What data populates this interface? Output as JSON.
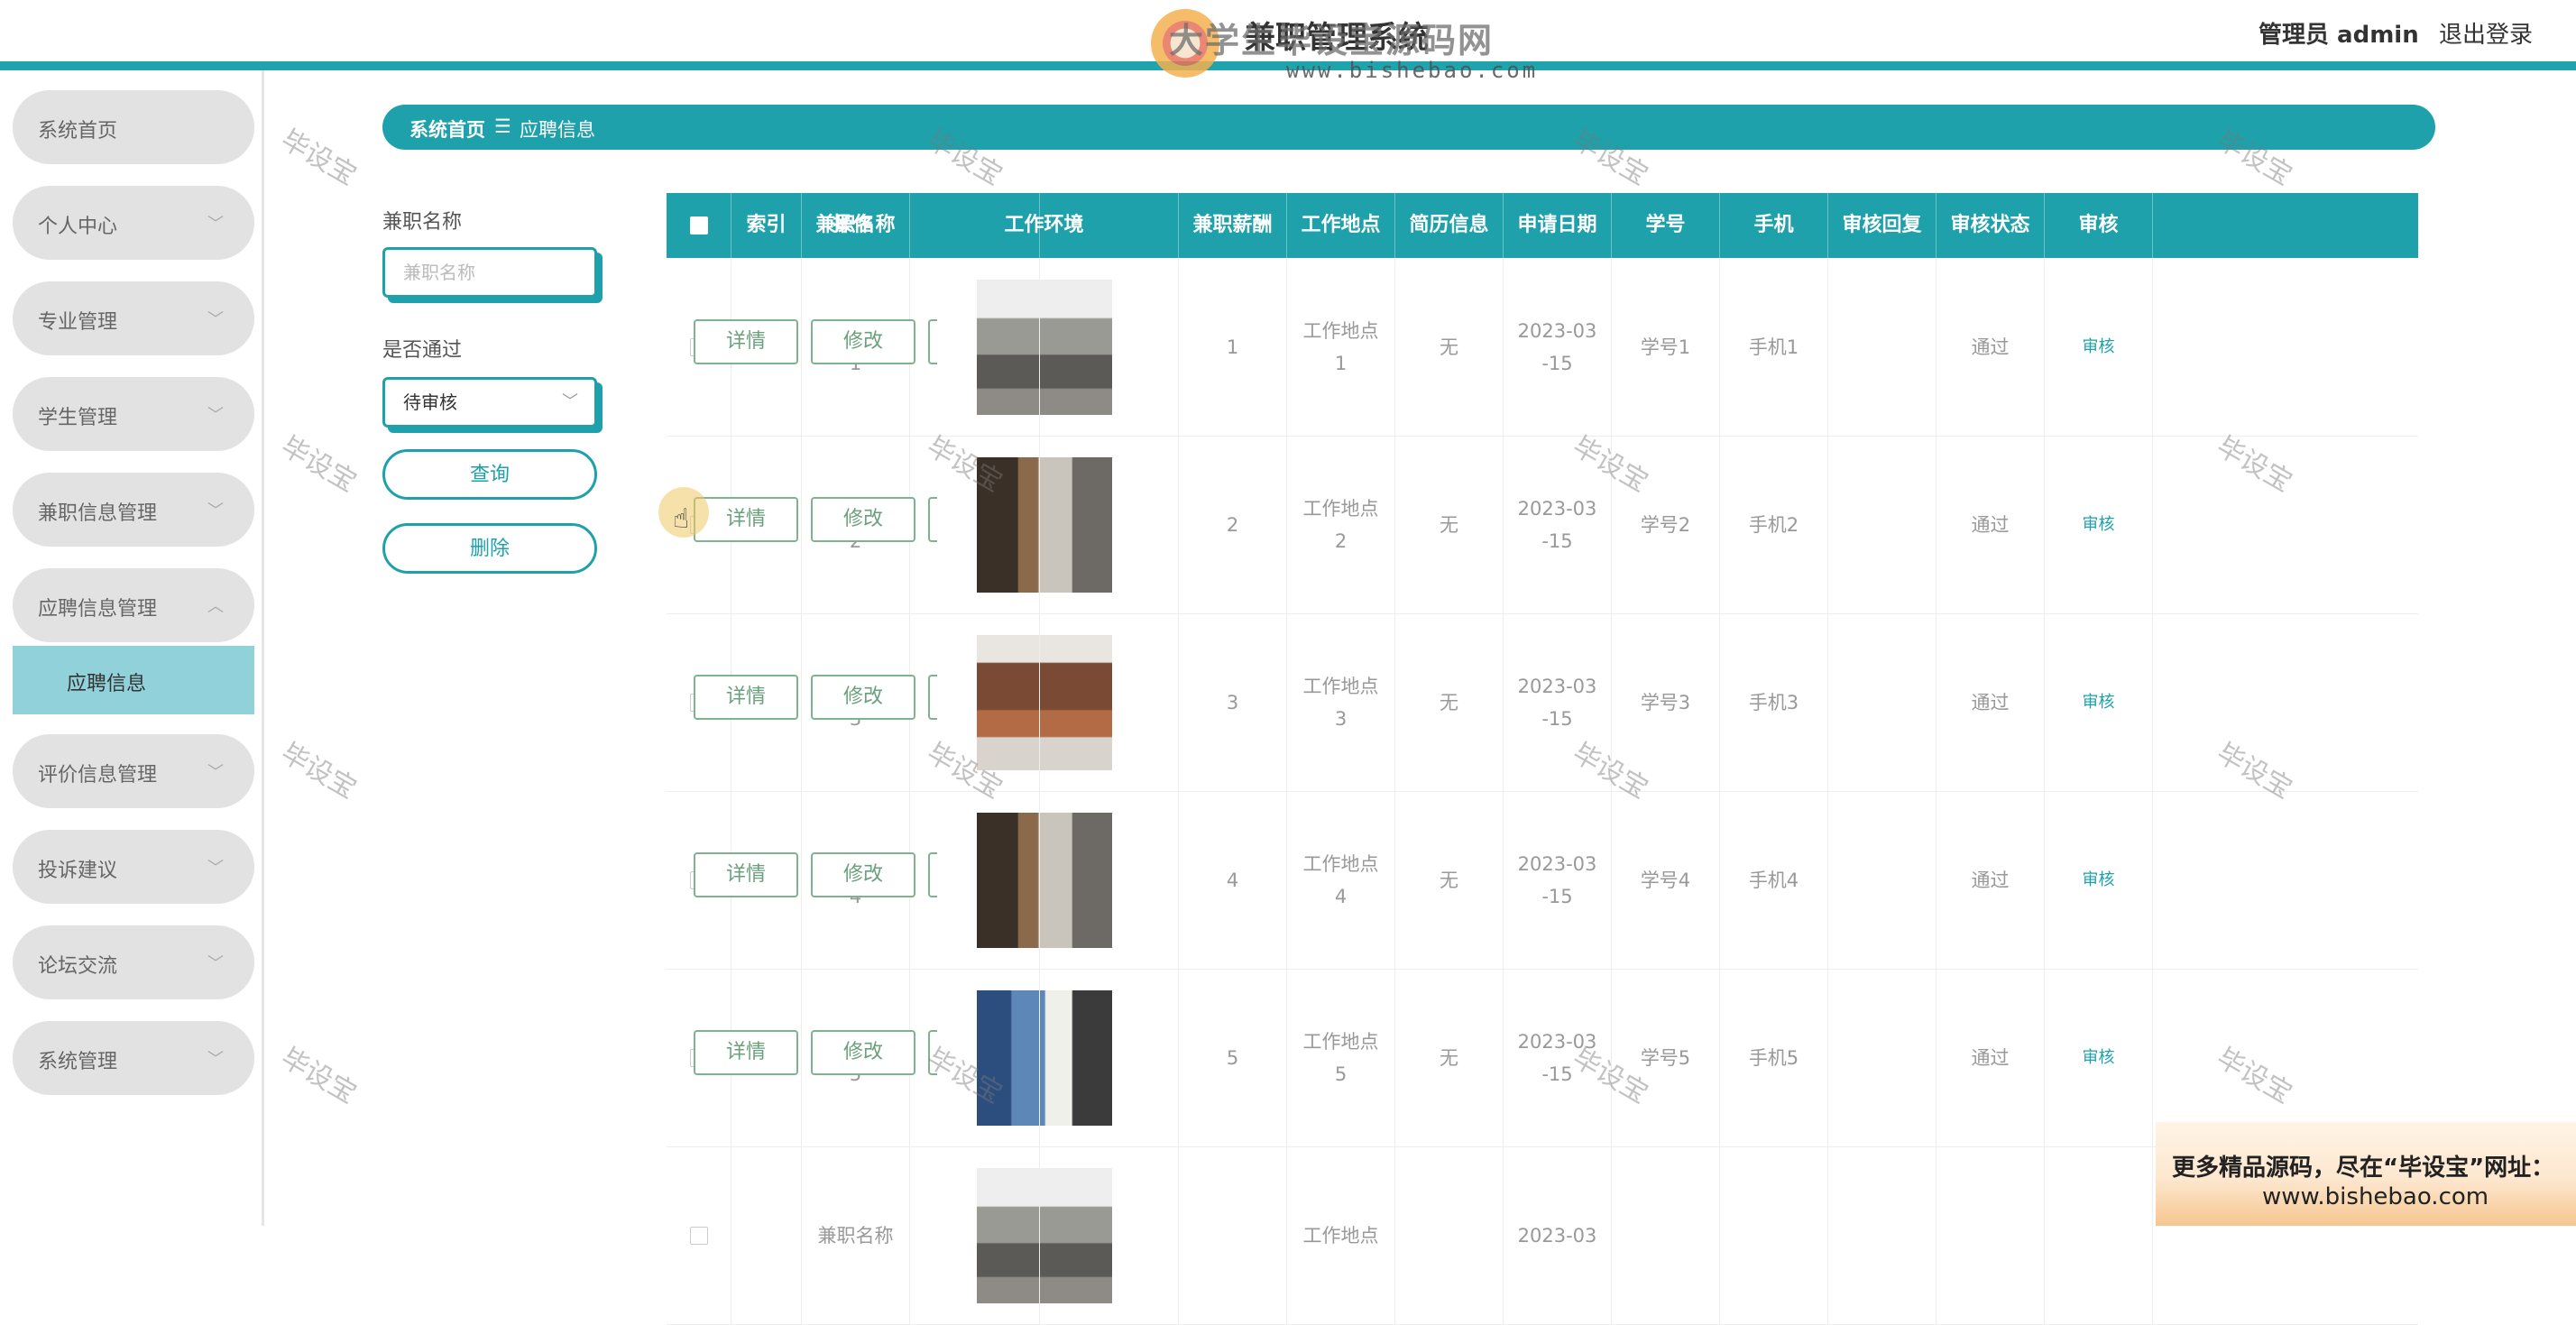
{
  "header": {
    "app_title": "兼职管理系统",
    "admin_label": "管理员 admin",
    "logout_label": "退出登录"
  },
  "watermark": {
    "logo_text": "大学生毕设宝源码网",
    "logo_url": "www.bishebao.com",
    "diagonal_text": "毕设宝"
  },
  "sidebar": {
    "items": [
      {
        "label": "系统首页",
        "has_arrow": false
      },
      {
        "label": "个人中心",
        "has_arrow": true
      },
      {
        "label": "专业管理",
        "has_arrow": true
      },
      {
        "label": "学生管理",
        "has_arrow": true
      },
      {
        "label": "兼职信息管理",
        "has_arrow": true
      },
      {
        "label": "应聘信息管理",
        "has_arrow": true,
        "expanded": true
      },
      {
        "label": "评价信息管理",
        "has_arrow": true
      },
      {
        "label": "投诉建议",
        "has_arrow": true
      },
      {
        "label": "论坛交流",
        "has_arrow": true
      },
      {
        "label": "系统管理",
        "has_arrow": true
      }
    ],
    "sub_item": "应聘信息",
    "chevron_down": "﹀",
    "chevron_up": "︿"
  },
  "breadcrumb": {
    "home": "系统首页",
    "separator": "☰",
    "current": "应聘信息"
  },
  "search": {
    "name_label": "兼职名称",
    "name_placeholder": "兼职名称",
    "pass_label": "是否通过",
    "pass_value": "待审核",
    "query_button": "查询",
    "delete_button": "删除"
  },
  "table": {
    "columns": [
      "索引",
      "兼职名称",
      "工作环境",
      "兼职薪酬",
      "工作地点",
      "简历信息",
      "申请日期",
      "学号",
      "手机",
      "审核回复",
      "审核状态",
      "审核",
      "操作"
    ],
    "rows": [
      {
        "index": "1",
        "name_l1": "兼职名称",
        "name_l2": "1",
        "image": "office-lounge",
        "pay": "1",
        "place_l1": "工作地点",
        "place_l2": "1",
        "resume": "无",
        "date_l1": "2023-03",
        "date_l2": "-15",
        "student_no": "学号1",
        "phone": "手机1",
        "reply": "",
        "status": "通过",
        "audit": "审核"
      },
      {
        "index": "2",
        "name_l1": "兼职名称",
        "name_l2": "2",
        "image": "office-stairs",
        "pay": "2",
        "place_l1": "工作地点",
        "place_l2": "2",
        "resume": "无",
        "date_l1": "2023-03",
        "date_l2": "-15",
        "student_no": "学号2",
        "phone": "手机2",
        "reply": "",
        "status": "通过",
        "audit": "审核"
      },
      {
        "index": "3",
        "name_l1": "兼职名称",
        "name_l2": "3",
        "image": "reception-desk",
        "pay": "3",
        "place_l1": "工作地点",
        "place_l2": "3",
        "resume": "无",
        "date_l1": "2023-03",
        "date_l2": "-15",
        "student_no": "学号3",
        "phone": "手机3",
        "reply": "",
        "status": "通过",
        "audit": "审核"
      },
      {
        "index": "4",
        "name_l1": "兼职名称",
        "name_l2": "4",
        "image": "office-stairs",
        "pay": "4",
        "place_l1": "工作地点",
        "place_l2": "4",
        "resume": "无",
        "date_l1": "2023-03",
        "date_l2": "-15",
        "student_no": "学号4",
        "phone": "手机4",
        "reply": "",
        "status": "通过",
        "audit": "审核"
      },
      {
        "index": "5",
        "name_l1": "兼职名称",
        "name_l2": "5",
        "image": "open-office",
        "pay": "5",
        "place_l1": "工作地点",
        "place_l2": "5",
        "resume": "无",
        "date_l1": "2023-03",
        "date_l2": "-15",
        "student_no": "学号5",
        "phone": "手机5",
        "reply": "",
        "status": "通过",
        "audit": "审核"
      },
      {
        "index": "",
        "name_l1": "兼职名称",
        "name_l2": "",
        "image": "office-lounge",
        "pay": "",
        "place_l1": "工作地点",
        "place_l2": "",
        "resume": "",
        "date_l1": "2023-03",
        "date_l2": "",
        "student_no": "",
        "phone": "",
        "reply": "",
        "status": "",
        "audit": ""
      }
    ],
    "action_detail": "详情",
    "action_edit": "修改"
  },
  "ad_banner": {
    "line1": "更多精品源码，尽在“毕设宝”网址：",
    "line2": "www.bishebao.com"
  },
  "colors": {
    "accent": "#1ea1ab",
    "sidebar_item": "#e2e2e2",
    "sidebar_active_sub": "#91d2da"
  }
}
